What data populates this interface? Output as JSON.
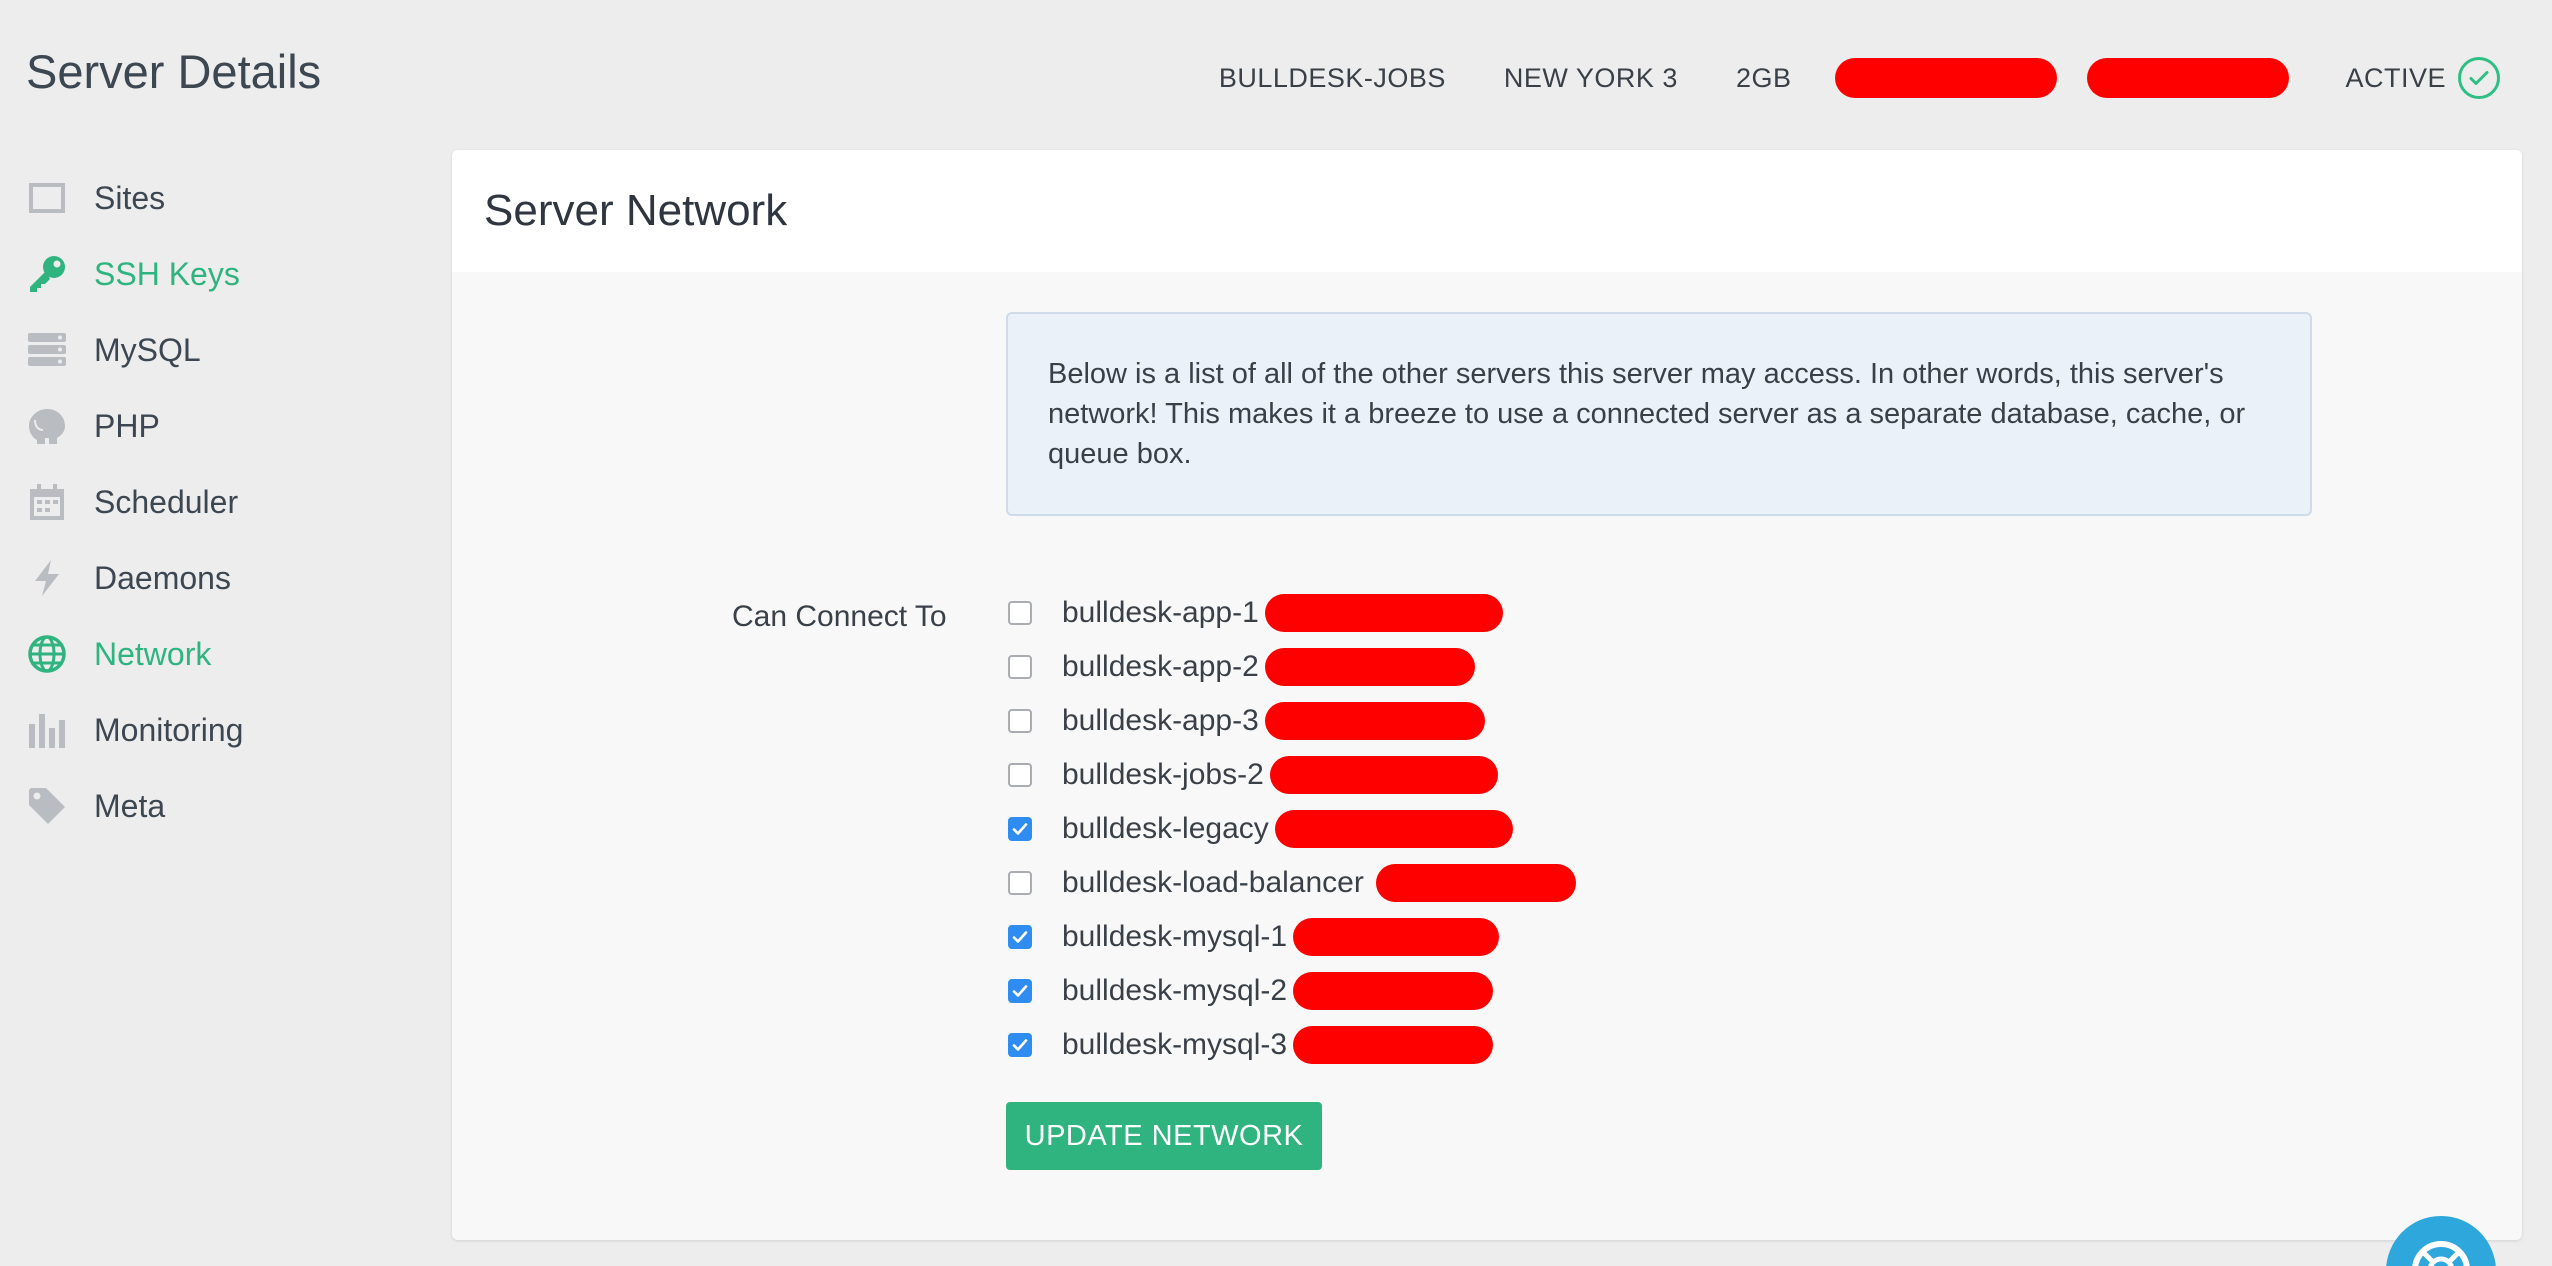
{
  "header": {
    "title": "Server Details",
    "server_name": "BULLDESK-JOBS",
    "region": "NEW YORK 3",
    "size": "2GB",
    "status": "ACTIVE",
    "status_icon": "check-circle-icon",
    "redaction_color": "#ff0000"
  },
  "sidebar": {
    "items": [
      {
        "label": "Sites",
        "icon": "window-icon",
        "active": false
      },
      {
        "label": "SSH Keys",
        "icon": "key-icon",
        "active": true
      },
      {
        "label": "MySQL",
        "icon": "server-stack-icon",
        "active": false
      },
      {
        "label": "PHP",
        "icon": "elephant-icon",
        "active": false
      },
      {
        "label": "Scheduler",
        "icon": "calendar-icon",
        "active": false
      },
      {
        "label": "Daemons",
        "icon": "bolt-icon",
        "active": false
      },
      {
        "label": "Network",
        "icon": "globe-icon",
        "active": true
      },
      {
        "label": "Monitoring",
        "icon": "bar-chart-icon",
        "active": false
      },
      {
        "label": "Meta",
        "icon": "tag-icon",
        "active": false
      }
    ]
  },
  "panel": {
    "title": "Server Network",
    "info": "Below is a list of all of the other servers this server may access. In other words, this server's network! This makes it a breeze to use a connected server as a separate database, cache, or queue box.",
    "connect_label": "Can Connect To",
    "servers": [
      {
        "name": "bulldesk-app-1",
        "checked": false
      },
      {
        "name": "bulldesk-app-2",
        "checked": false
      },
      {
        "name": "bulldesk-app-3",
        "checked": false
      },
      {
        "name": "bulldesk-jobs-2",
        "checked": false
      },
      {
        "name": "bulldesk-legacy",
        "checked": true
      },
      {
        "name": "bulldesk-load-balancer",
        "checked": false
      },
      {
        "name": "bulldesk-mysql-1",
        "checked": true
      },
      {
        "name": "bulldesk-mysql-2",
        "checked": true
      },
      {
        "name": "bulldesk-mysql-3",
        "checked": true
      }
    ],
    "update_button": "UPDATE NETWORK"
  },
  "colors": {
    "accent_green": "#2fb47f",
    "checkbox_blue": "#2f8cf0",
    "info_bg": "#eaf1f9",
    "help_blue": "#2ea7dd"
  },
  "help": {
    "icon": "lifebuoy-icon"
  }
}
